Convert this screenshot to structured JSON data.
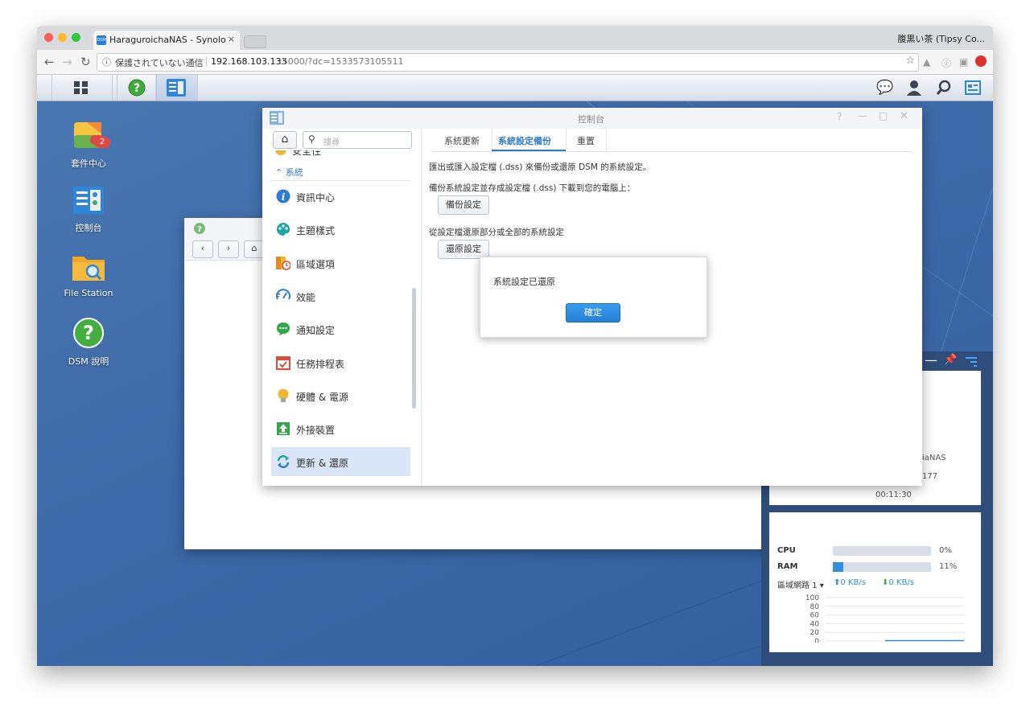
{
  "browser": {
    "tab_title": "HaraguroichaNAS - Synology",
    "tab_close": "×",
    "favicon_text": "DSM",
    "profile": "腹黒い茶 (Tipsy Co...",
    "address": {
      "security_label": "保護されていない通信",
      "host": "192.168.103.133",
      "path": ":5000/?dc=1533573105511"
    }
  },
  "desktop": {
    "icons": [
      {
        "label": "套件中心",
        "badge": "2"
      },
      {
        "label": "控制台"
      },
      {
        "label": "File Station"
      },
      {
        "label": "DSM 說明"
      }
    ]
  },
  "control_panel": {
    "title": "控制台",
    "search_placeholder": "搜尋",
    "partial_item": "安全性",
    "section": "系統",
    "items": [
      {
        "label": "資訊中心",
        "icon": "info-icon",
        "color": "#2d7bd3"
      },
      {
        "label": "主題樣式",
        "icon": "palette-icon",
        "color": "#1fa3a6"
      },
      {
        "label": "區域選項",
        "icon": "map-clock-icon",
        "color": "#e8891c"
      },
      {
        "label": "效能",
        "icon": "performance-icon",
        "color": "#2d7bd3"
      },
      {
        "label": "通知設定",
        "icon": "chat-icon",
        "color": "#33a64a"
      },
      {
        "label": "任務排程表",
        "icon": "calendar-icon",
        "color": "#e14b3b"
      },
      {
        "label": "硬體 & 電源",
        "icon": "bulb-icon",
        "color": "#f2b531"
      },
      {
        "label": "外接裝置",
        "icon": "upload-icon",
        "color": "#33a64a"
      },
      {
        "label": "更新 & 還原",
        "icon": "refresh-icon",
        "color": "#1fa3a6"
      }
    ],
    "tabs": [
      "系統更新",
      "系統設定備份",
      "重置"
    ],
    "active_tab": 1,
    "content": {
      "desc": "匯出或匯入設定檔 (.dss) 來備份或還原 DSM 的系統設定。",
      "backup_text": "備份系統設定並存成設定檔 (.dss) 下載到您的電腦上：",
      "backup_button": "備份設定",
      "restore_text": "從設定檔還原部分或全部的系統設定",
      "restore_button": "還原設定"
    },
    "dialog": {
      "message": "系統設定已還原",
      "ok_button": "確定"
    }
  },
  "widget": {
    "info_partial": [
      "iaNAS",
      "177"
    ],
    "uptime": "00:11:30",
    "cpu_label": "CPU",
    "cpu_percent": 0,
    "cpu_value": "0%",
    "ram_label": "RAM",
    "ram_percent": 11,
    "ram_value": "11%",
    "network_label": "區域網路 1",
    "upload": "0 KB/s",
    "download": "0 KB/s",
    "chart_ticks": [
      "100",
      "80",
      "60",
      "40",
      "20",
      "0"
    ]
  },
  "colors": {
    "accent": "#2d84d6",
    "desktop_bg": "#3d6aa8"
  }
}
